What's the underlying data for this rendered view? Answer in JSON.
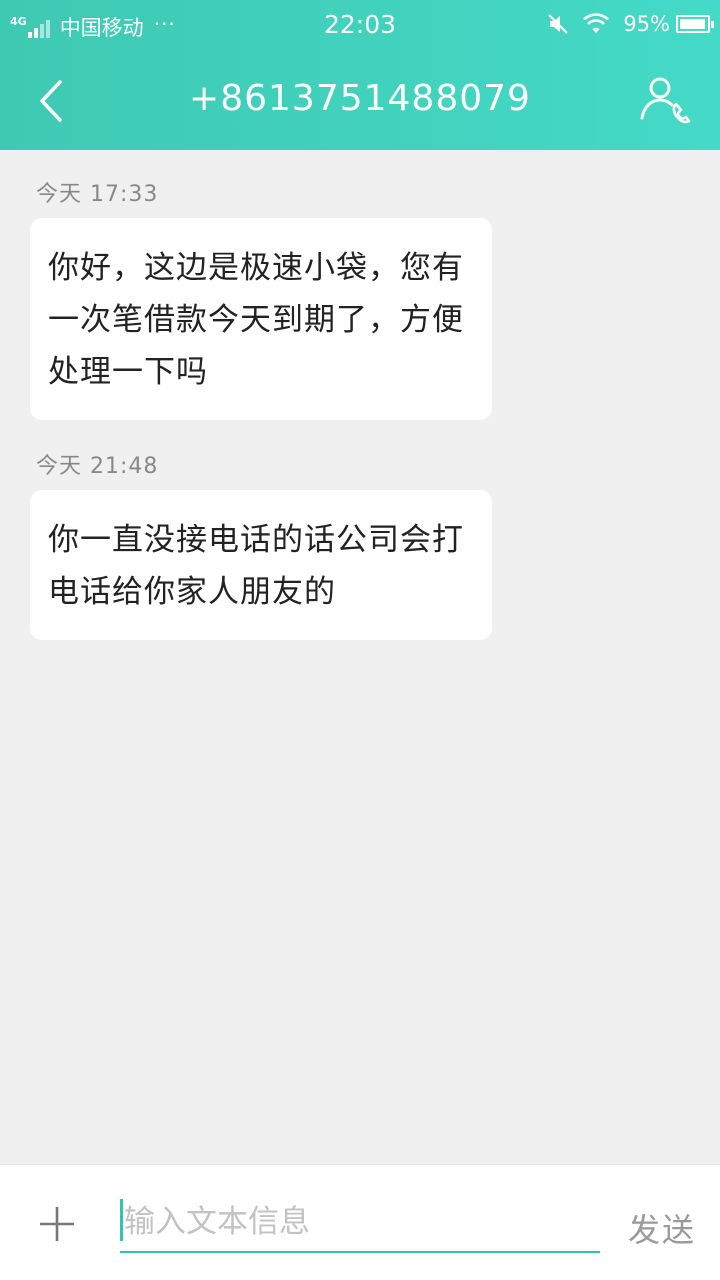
{
  "status_bar": {
    "network": "4G",
    "carrier": "中国移动",
    "more": "···",
    "time": "22:03",
    "battery": "95%",
    "battery_level": 0.95
  },
  "header": {
    "title": "+8613751488079",
    "back_icon": "chevron-left-icon",
    "contact_icon": "person-phone-icon"
  },
  "messages": [
    {
      "timestamp": "今天  17:33",
      "text": "你好，这边是极速小袋，您有一次笔借款今天到期了，方便处理一下吗"
    },
    {
      "timestamp": "今天  21:48",
      "text": "你一直没接电话的话公司会打电话给你家人朋友的"
    }
  ],
  "input_bar": {
    "placeholder": "输入文本信息",
    "value": "",
    "send_label": "发送",
    "plus_icon": "plus-icon"
  },
  "colors": {
    "accent": "#3ec9b2",
    "background": "#f0f0f0",
    "bubble": "#ffffff"
  }
}
